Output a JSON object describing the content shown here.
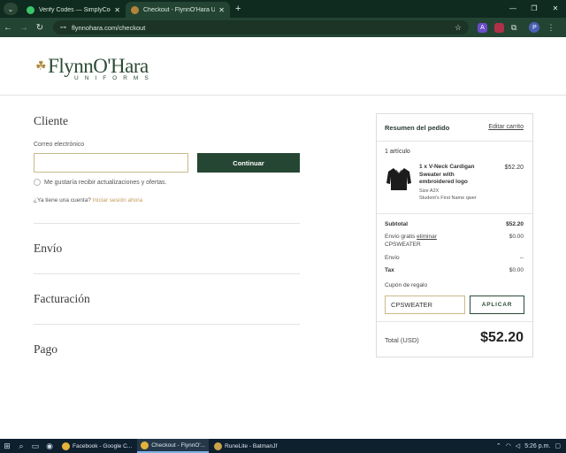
{
  "browser": {
    "tabs": [
      {
        "title": "Verify Codes — SimplyCodes",
        "active": false
      },
      {
        "title": "Checkout - FlynnO'Hara Uniforms",
        "active": true
      }
    ],
    "url": "flynnohara.com/checkout",
    "profile_initial": "P",
    "ext_a": "A"
  },
  "logo": {
    "main": "FlynnO'Hara",
    "sub": "UNIFORMS"
  },
  "checkout": {
    "customer_title": "Cliente",
    "email_label": "Correo electrónico",
    "email_value": "",
    "continue_label": "Continuar",
    "newsletter_label": "Me gustaría recibir actualizaciones y ofertas.",
    "login_prompt": "¿Ya tiene una cuenta?",
    "login_link": "Iniciar sesión ahora",
    "shipping_title": "Envío",
    "billing_title": "Facturación",
    "payment_title": "Pago"
  },
  "summary": {
    "title": "Resumen del pedido",
    "edit_label": "Editar carrito",
    "items_count": "1 artículo",
    "product": {
      "name": "1 x V-Neck Cardigan Sweater with embroidered logo",
      "price": "$52.20",
      "size": "Size A2X",
      "personalization": "Student's First Name qwer"
    },
    "subtotal_label": "Subtotal",
    "subtotal_value": "$52.20",
    "free_shipping_label": "Envío gratis",
    "remove_label": "eliminar",
    "coupon_code": "CPSWEATER",
    "free_shipping_value": "$0.00",
    "shipping_label": "Envío",
    "shipping_value": "--",
    "tax_label": "Tax",
    "tax_value": "$0.00",
    "coupon_label": "Cupón de regalo",
    "coupon_input": "CPSWEATER",
    "apply_label": "APLICAR",
    "total_label": "Total (USD)",
    "total_value": "$52.20"
  },
  "taskbar": {
    "apps": [
      {
        "label": "Facebook - Google C..."
      },
      {
        "label": "Checkout - FlynnO'..."
      },
      {
        "label": "RuneLite - BatmanJf"
      }
    ],
    "time": "5:26 p.m."
  },
  "colors": {
    "brand_green": "#254632",
    "gold": "#b08a3f",
    "input_border": "#c9b98c"
  }
}
